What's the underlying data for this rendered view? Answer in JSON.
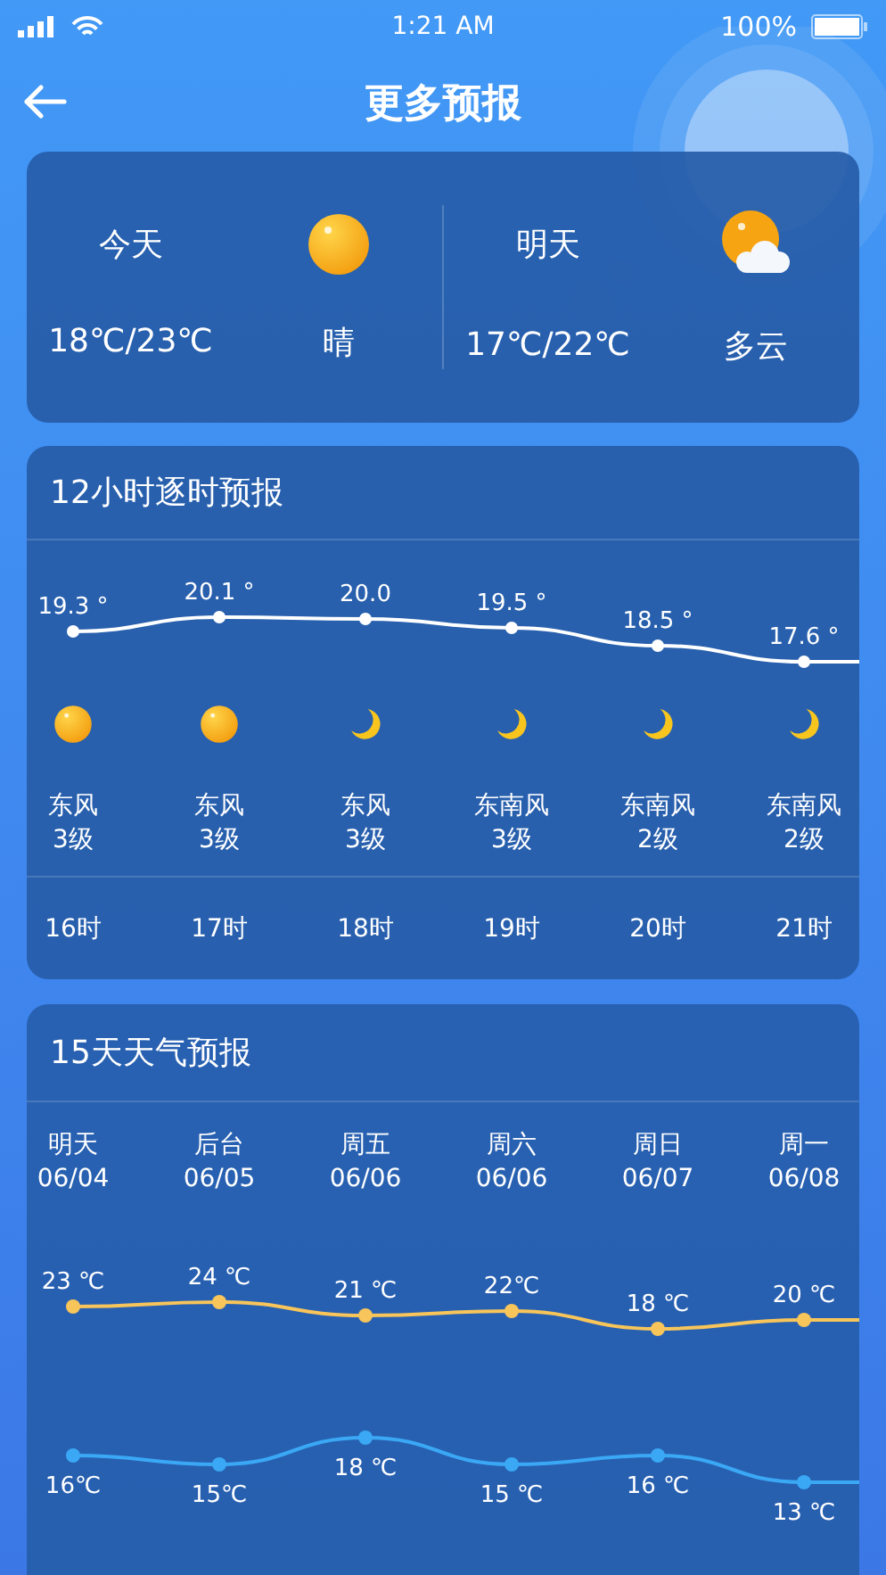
{
  "status_bar": {
    "time": "1:21 AM",
    "battery": "100%"
  },
  "header": {
    "title": "更多预报"
  },
  "summary": [
    {
      "day": "今天",
      "kind": "sun",
      "temps": "18℃/23℃",
      "condition": "晴"
    },
    {
      "day": "明天",
      "kind": "cloud_sun",
      "temps": "17℃/22℃",
      "condition": "多云"
    }
  ],
  "hourly": {
    "title": "12小时逐时预报",
    "chart_data": {
      "type": "line",
      "categories": [
        "16时",
        "17时",
        "18时",
        "19时",
        "20时",
        "21时"
      ],
      "series": [
        {
          "color": "#ffffff",
          "marker": "circle",
          "values": [
            19.3,
            20.1,
            20.0,
            19.5,
            18.5,
            17.6
          ],
          "value_labels": [
            "19.3 °",
            "20.1 °",
            "20.0",
            "19.5 °",
            "18.5 °",
            "17.6 °"
          ]
        }
      ]
    },
    "items": [
      {
        "kind": "sun",
        "wind": "东风",
        "wind_level": "3级"
      },
      {
        "kind": "sun",
        "wind": "东风",
        "wind_level": "3级"
      },
      {
        "kind": "moon",
        "wind": "东风",
        "wind_level": "3级"
      },
      {
        "kind": "moon",
        "wind": "东南风",
        "wind_level": "3级"
      },
      {
        "kind": "moon",
        "wind": "东南风",
        "wind_level": "2级"
      },
      {
        "kind": "moon",
        "wind": "东南风",
        "wind_level": "2级"
      }
    ]
  },
  "daily": {
    "title": "15天天气预报",
    "dates": [
      "06/04",
      "06/05",
      "06/06",
      "06/06",
      "06/07",
      "06/08"
    ],
    "chart_data": {
      "type": "line",
      "categories": [
        "明天",
        "后台",
        "周五",
        "周六",
        "周日",
        "周一"
      ],
      "series": [
        {
          "color": "#f7c55a",
          "marker": "circle",
          "values": [
            23,
            24,
            21,
            22,
            18,
            20
          ],
          "value_labels": [
            "23 ℃",
            "24 ℃",
            "21 ℃",
            "22℃",
            "18 ℃",
            "20 ℃"
          ]
        }
      ]
    },
    "low_chart": {
      "chart_data": {
        "type": "line",
        "series": [
          {
            "color": "#3aa8f5",
            "marker": "circle",
            "values": [
              16,
              15,
              18,
              15,
              16,
              13
            ],
            "value_labels": [
              "16℃",
              "15℃",
              "18 ℃",
              "15 ℃",
              "16 ℃",
              "13 ℃"
            ]
          }
        ]
      }
    }
  }
}
